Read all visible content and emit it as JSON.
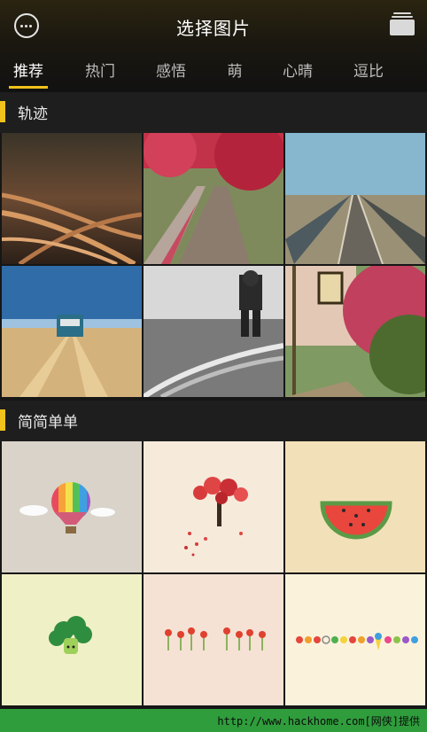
{
  "header": {
    "title": "选择图片"
  },
  "tabs": [
    {
      "label": "推荐"
    },
    {
      "label": "热门"
    },
    {
      "label": "感悟"
    },
    {
      "label": "萌"
    },
    {
      "label": "心晴"
    },
    {
      "label": "逗比"
    }
  ],
  "sections": [
    {
      "title": "轨迹"
    },
    {
      "title": "简简单单"
    }
  ],
  "footer": {
    "text": "http://www.hackhome.com[网侠]提供"
  },
  "colors": {
    "accent": "#f1c21b",
    "footer_bg": "#2f9d3c"
  }
}
